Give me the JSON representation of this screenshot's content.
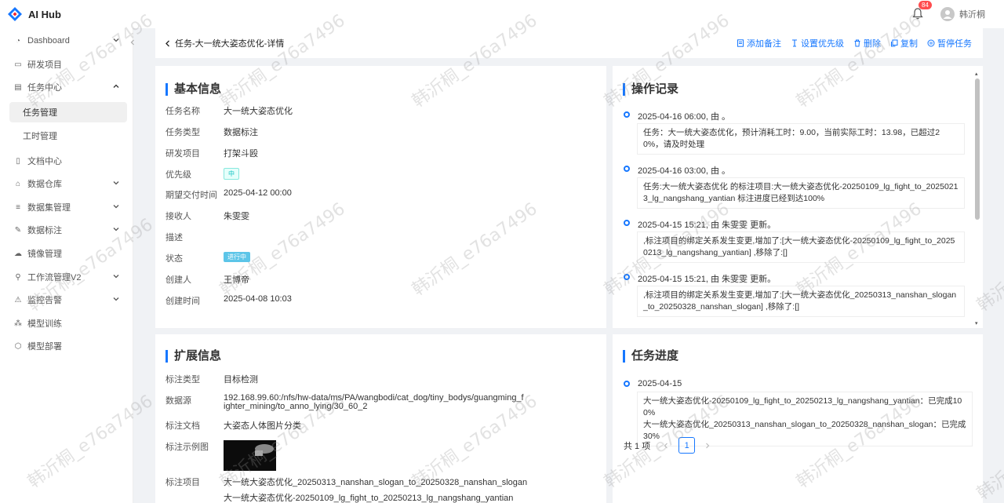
{
  "app": {
    "name": "AI Hub",
    "notification_count": "84",
    "user_name": "韩沂桐"
  },
  "sidebar": {
    "items": [
      {
        "label": "Dashboard",
        "icon": "dashboard-icon"
      },
      {
        "label": "研发项目",
        "icon": "folder-icon"
      },
      {
        "label": "任务中心",
        "icon": "clipboard-icon"
      },
      {
        "label": "任务管理"
      },
      {
        "label": "工时管理"
      },
      {
        "label": "文档中心",
        "icon": "document-icon"
      },
      {
        "label": "数据仓库",
        "icon": "home-icon"
      },
      {
        "label": "数据集管理",
        "icon": "database-icon"
      },
      {
        "label": "数据标注",
        "icon": "edit-icon"
      },
      {
        "label": "镜像管理",
        "icon": "cloud-icon"
      },
      {
        "label": "工作流管理V2",
        "icon": "flow-icon"
      },
      {
        "label": "监控告警",
        "icon": "warning-icon"
      },
      {
        "label": "模型训练",
        "icon": "nodes-icon"
      },
      {
        "label": "模型部署",
        "icon": "cube-icon"
      }
    ]
  },
  "page": {
    "title": "任务-大一统大姿态优化-详情",
    "actions": [
      "添加备注",
      "设置优先级",
      "删除",
      "复制",
      "暂停任务"
    ]
  },
  "basic": {
    "title": "基本信息",
    "fields": [
      {
        "label": "任务名称",
        "value": "大一统大姿态优化"
      },
      {
        "label": "任务类型",
        "value": "数据标注"
      },
      {
        "label": "研发项目",
        "value": "打架斗殴"
      },
      {
        "label": "优先级",
        "value": "中"
      },
      {
        "label": "期望交付时间",
        "value": "2025-04-12 00:00"
      },
      {
        "label": "接收人",
        "value": "朱雯雯"
      },
      {
        "label": "描述",
        "value": ""
      },
      {
        "label": "状态",
        "value": "进行中"
      },
      {
        "label": "创建人",
        "value": "王博帝"
      },
      {
        "label": "创建时间",
        "value": "2025-04-08 10:03"
      }
    ]
  },
  "oplog": {
    "title": "操作记录",
    "items": [
      {
        "time": "2025-04-16 06:00, 由 。",
        "text": "任务：大一统大姿态优化，预计消耗工时：9.00，当前实际工时：13.98，已超过20%，请及时处理"
      },
      {
        "time": "2025-04-16 03:00, 由 。",
        "text": "任务:大一统大姿态优化 的标注项目:大一统大姿态优化-20250109_lg_fight_to_20250213_lg_nangshang_yantian 标注进度已经到达100%"
      },
      {
        "time": "2025-04-15 15:21, 由 朱雯雯 更新。",
        "text": ",标注项目的绑定关系发生变更,增加了:[大一统大姿态优化-20250109_lg_fight_to_20250213_lg_nangshang_yantian] ,移除了:[]"
      },
      {
        "time": "2025-04-15 15:21, 由 朱雯雯 更新。",
        "text": ",标注项目的绑定关系发生变更,增加了:[大一统大姿态优化_20250313_nanshan_slogan_to_20250328_nanshan_slogan] ,移除了:[]"
      }
    ]
  },
  "ext": {
    "title": "扩展信息",
    "fields": [
      {
        "label": "标注类型",
        "value": "目标检测"
      },
      {
        "label": "数据源",
        "value": "192.168.99.60:/nfs/hw-data/ms/PA/wangbodi/cat_dog/tiny_bodys/guangming_fighter_mining/to_anno_lying/30_60_2"
      },
      {
        "label": "标注文档",
        "value": "大姿态人体图片分类"
      },
      {
        "label": "标注示例图",
        "value": ""
      },
      {
        "label": "标注项目",
        "value": "大一统大姿态优化_20250313_nanshan_slogan_to_20250328_nanshan_slogan"
      }
    ],
    "project_link_2": "大一统大姿态优化-20250109_lg_fight_to_20250213_lg_nangshang_yantian"
  },
  "progress": {
    "title": "任务进度",
    "date": "2025-04-15",
    "lines": [
      "大一统大姿态优化-20250109_lg_fight_to_20250213_lg_nangshang_yantian：已完成100%",
      "大一统大姿态优化_20250313_nanshan_slogan_to_20250328_nanshan_slogan：已完成30%"
    ],
    "total": "共 1 项",
    "page": "1"
  },
  "watermark": "韩沂桐_e76a7496",
  "colors": {
    "primary": "#1677ff",
    "accent": "#13c2c2",
    "danger": "#ff4d4f"
  }
}
